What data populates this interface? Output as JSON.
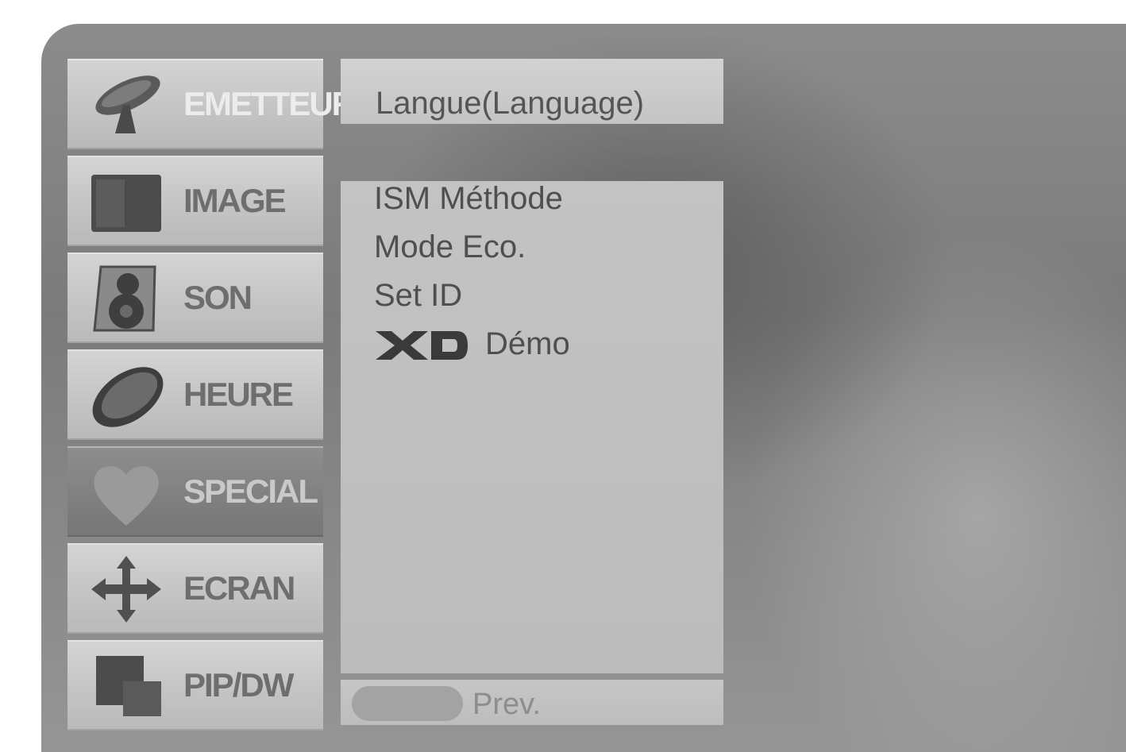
{
  "menu": {
    "items": [
      {
        "label": "EMETTEUR",
        "icon": "satellite-dish-icon"
      },
      {
        "label": "IMAGE",
        "icon": "screen-icon"
      },
      {
        "label": "SON",
        "icon": "speaker-icon"
      },
      {
        "label": "HEURE",
        "icon": "clock-icon"
      },
      {
        "label": "SPECIAL",
        "icon": "heart-icon",
        "selected": true
      },
      {
        "label": "ECRAN",
        "icon": "move-arrows-icon"
      },
      {
        "label": "PIP/DW",
        "icon": "pip-icon"
      }
    ]
  },
  "submenu": {
    "title": "Langue(Language)",
    "items": [
      {
        "label": "ISM Méthode"
      },
      {
        "label": "Mode Eco."
      },
      {
        "label": "Set ID"
      },
      {
        "label": "Démo",
        "logo": "XD"
      }
    ],
    "footer": {
      "prev_label": "Prev."
    }
  }
}
